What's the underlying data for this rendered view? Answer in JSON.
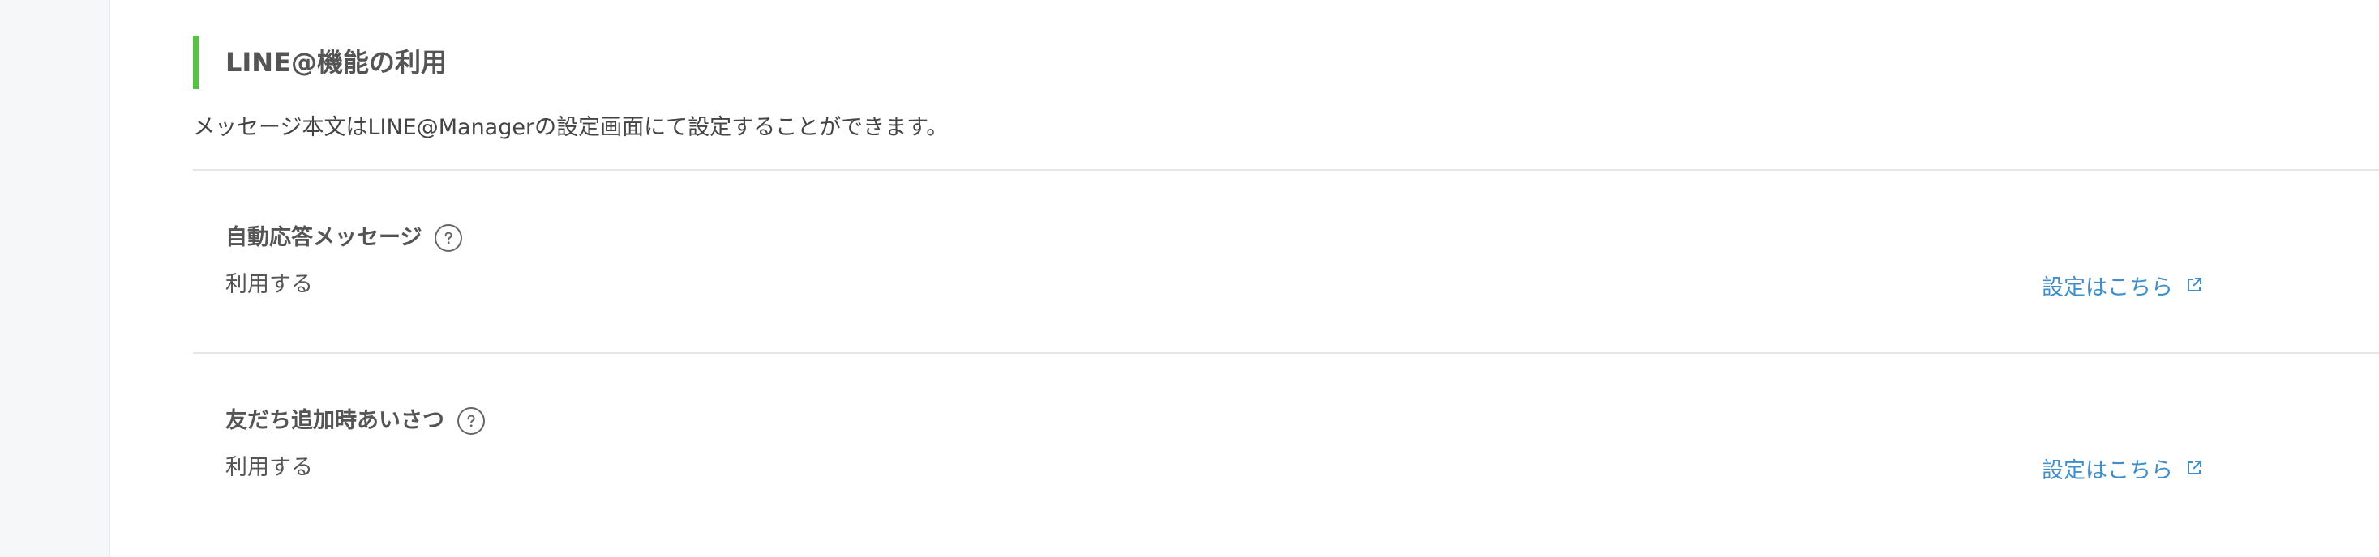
{
  "colors": {
    "accent": "#5cbf4a",
    "link": "#3f8fca",
    "text": "#555555",
    "divider": "#e4e6e9"
  },
  "section": {
    "title": "LINE@機能の利用",
    "description": "メッセージ本文はLINE@Managerの設定画面にて設定することができます。"
  },
  "settings": [
    {
      "title": "自動応答メッセージ",
      "help_icon": "question-circle-icon",
      "value": "利用する",
      "link_label": "設定はこちら",
      "link_icon": "external-link-icon"
    },
    {
      "title": "友だち追加時あいさつ",
      "help_icon": "question-circle-icon",
      "value": "利用する",
      "link_label": "設定はこちら",
      "link_icon": "external-link-icon"
    }
  ]
}
